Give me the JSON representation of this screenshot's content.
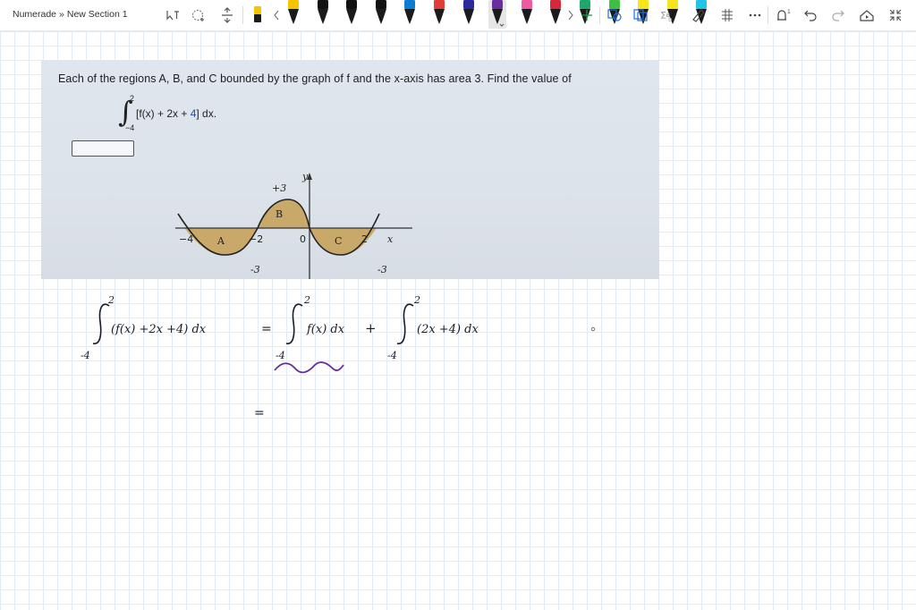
{
  "toolbar": {
    "breadcrumb": {
      "notebook": "Numerade",
      "separator": "»",
      "section": "New Section 1"
    },
    "icons": [
      "lasso-select-icon",
      "add-space-icon",
      "insert-space-icon",
      "eraser-icon",
      "scroll-left-icon",
      "scroll-right-icon",
      "add-pen-icon",
      "shapes-icon",
      "copy-icon",
      "math-icon",
      "ruler-icon",
      "more-icon",
      "touch-draw-icon",
      "undo-icon",
      "redo-icon",
      "replay-icon",
      "collapse-icon"
    ],
    "pens": [
      {
        "color": "#f5c400"
      },
      {
        "color": "#111111"
      },
      {
        "color": "#111111"
      },
      {
        "color": "#111111"
      },
      {
        "color": "#0a7cd4"
      },
      {
        "color": "#e23b3b"
      },
      {
        "color": "#2a2a9e"
      },
      {
        "color": "#6a2ea0",
        "selected": true
      },
      {
        "color": "#f05aa0"
      },
      {
        "color": "#d6283c"
      },
      {
        "color": "#1da86a"
      },
      {
        "color": "#3fbf3f"
      },
      {
        "color": "#f5e51a"
      },
      {
        "color": "#f5e51a"
      },
      {
        "color": "#21c3e6"
      }
    ]
  },
  "problem": {
    "question": "Each of the regions A, B, and C bounded by the graph of f and the x-axis has area 3. Find the value of",
    "integral": {
      "upper": "2",
      "lower": "−4",
      "expr_start": "[f(x) + 2x + ",
      "expr_blue": "4",
      "expr_end": "] dx."
    },
    "graph": {
      "y_label": "y",
      "x_label": "x",
      "region_labels": [
        "A",
        "B",
        "C"
      ],
      "x_ticks": [
        "−4",
        "−2",
        "0",
        "2"
      ],
      "y_annotations": [
        "+3",
        "-3",
        "-3"
      ]
    }
  },
  "handwriting": {
    "line1": {
      "upper": "2",
      "lower": "-4",
      "integrand": "(f(x) +2x +4) dx",
      "equals": "=",
      "term1": "f(x) dx",
      "plus": "+",
      "term2": "(2x +4) dx"
    },
    "line2_equals": "="
  },
  "colors": {
    "accent_purple": "#6a2ea0",
    "region_fill": "#c9a96a",
    "page_grid": "#e3ecf4"
  }
}
